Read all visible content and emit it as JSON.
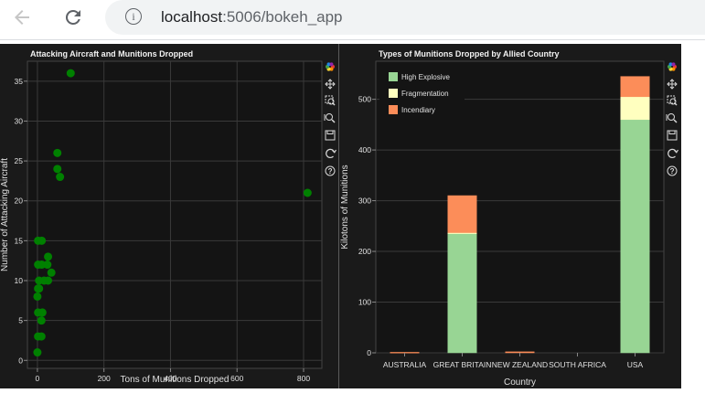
{
  "browser": {
    "url_host": "localhost",
    "url_rest": ":5006/bokeh_app",
    "icons": [
      "back-arrow-icon",
      "reload-icon",
      "info-icon"
    ]
  },
  "theme": {
    "figure_bg": "#1a1a1a",
    "plot_bg": "#141414",
    "grid_color": "#3a3a3a",
    "text_color": "#e0e0e0",
    "title_color": "#f2f2f2",
    "scatter_color": "#008000"
  },
  "toolbar_icons": [
    "bokeh-logo-icon",
    "pan-icon",
    "box-zoom-icon",
    "wheel-zoom-icon",
    "save-icon",
    "reset-icon",
    "help-icon"
  ],
  "chart_data": [
    {
      "type": "scatter",
      "title": "Attacking Aircraft and Munitions Dropped",
      "xlabel": "Tons of Munitions Dropped",
      "ylabel": "Number of Attacking Aircraft",
      "xlim": [
        -30,
        855
      ],
      "ylim": [
        -1,
        37.5
      ],
      "xticks": [
        0,
        200,
        400,
        600,
        800
      ],
      "yticks": [
        0,
        5,
        10,
        15,
        20,
        25,
        30,
        35
      ],
      "grid": true,
      "points": [
        [
          100,
          36
        ],
        [
          60,
          26
        ],
        [
          60,
          24
        ],
        [
          68,
          23
        ],
        [
          812,
          21
        ],
        [
          2,
          15
        ],
        [
          13,
          15
        ],
        [
          32,
          13
        ],
        [
          30,
          12
        ],
        [
          42,
          11
        ],
        [
          2,
          12
        ],
        [
          13,
          12
        ],
        [
          5,
          10
        ],
        [
          20,
          10
        ],
        [
          32,
          10
        ],
        [
          2,
          9
        ],
        [
          5,
          9
        ],
        [
          0,
          8
        ],
        [
          2,
          6
        ],
        [
          15,
          6
        ],
        [
          12,
          5
        ],
        [
          2,
          3
        ],
        [
          12,
          3
        ],
        [
          0,
          1
        ]
      ]
    },
    {
      "type": "bar",
      "stacked": true,
      "title": "Types of Munitions Dropped by Allied Country",
      "xlabel": "Country",
      "ylabel": "Kilotons of Munitions",
      "categories": [
        "AUSTRALIA",
        "GREAT BRITAIN",
        "NEW ZEALAND",
        "SOUTH AFRICA",
        "USA"
      ],
      "ylim": [
        0,
        575
      ],
      "yticks": [
        0,
        100,
        200,
        300,
        400,
        500
      ],
      "grid": true,
      "legend_position": "top-left",
      "series": [
        {
          "name": "High Explosive",
          "color": "#98d594",
          "values": [
            0,
            235,
            0,
            0,
            460
          ]
        },
        {
          "name": "Fragmentation",
          "color": "#ffffbf",
          "values": [
            0,
            2,
            0,
            0,
            45
          ]
        },
        {
          "name": "Incendiary",
          "color": "#fc8d59",
          "values": [
            1,
            73,
            2,
            0,
            40
          ]
        }
      ]
    }
  ]
}
